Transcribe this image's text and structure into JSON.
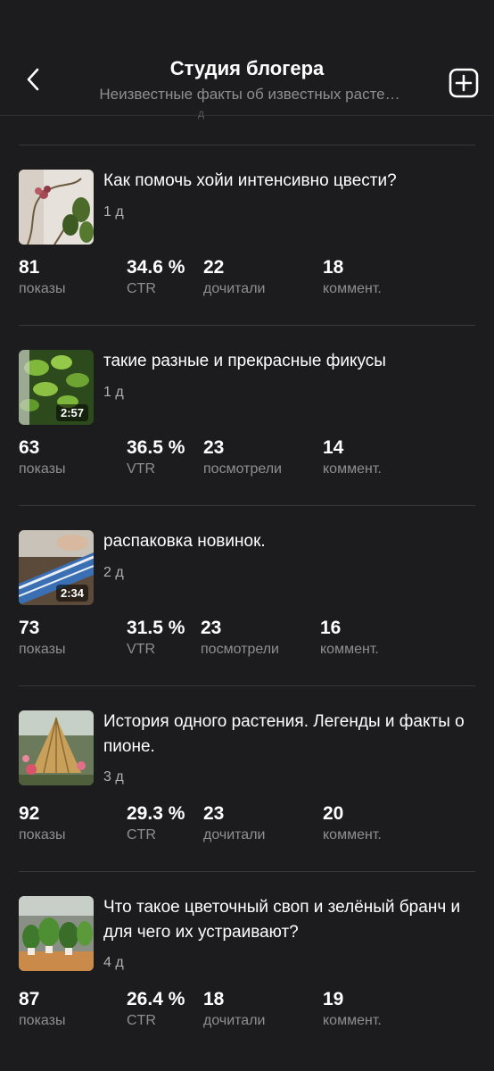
{
  "header": {
    "title": "Студия блогера",
    "subtitle": "Неизвестные факты об известных расте…",
    "back_icon": "chevron-left-icon",
    "add_icon": "plus-square-icon",
    "clipped_text": "д"
  },
  "items": [
    {
      "title": "Как помочь хойи интенсивно цвести?",
      "age": "1 д",
      "duration": "",
      "stats": [
        {
          "value": "81",
          "label": "показы"
        },
        {
          "value": "34.6 %",
          "label": "CTR"
        },
        {
          "value": "22",
          "label": "дочитали"
        },
        {
          "value": "18",
          "label": "коммент."
        }
      ]
    },
    {
      "title": "такие разные и прекрасные фикусы",
      "age": "1 д",
      "duration": "2:57",
      "stats": [
        {
          "value": "63",
          "label": "показы"
        },
        {
          "value": "36.5 %",
          "label": "VTR"
        },
        {
          "value": "23",
          "label": "посмотрели"
        },
        {
          "value": "14",
          "label": "коммент."
        }
      ]
    },
    {
      "title": "распаковка новинок.",
      "age": "2 д",
      "duration": "2:34",
      "stats": [
        {
          "value": "73",
          "label": "показы"
        },
        {
          "value": "31.5 %",
          "label": "VTR"
        },
        {
          "value": "23",
          "label": "посмотрели"
        },
        {
          "value": "16",
          "label": "коммент."
        }
      ]
    },
    {
      "title": "История одного растения. Легенды и факты о пионе.",
      "age": "3 д",
      "duration": "",
      "stats": [
        {
          "value": "92",
          "label": "показы"
        },
        {
          "value": "29.3 %",
          "label": "CTR"
        },
        {
          "value": "23",
          "label": "дочитали"
        },
        {
          "value": "20",
          "label": "коммент."
        }
      ]
    },
    {
      "title": "Что такое цветочный своп и зелёный бранч и для чего их устраивают?",
      "age": "4 д",
      "duration": "",
      "stats": [
        {
          "value": "87",
          "label": "показы"
        },
        {
          "value": "26.4 %",
          "label": "CTR"
        },
        {
          "value": "18",
          "label": "дочитали"
        },
        {
          "value": "19",
          "label": "коммент."
        }
      ]
    }
  ]
}
